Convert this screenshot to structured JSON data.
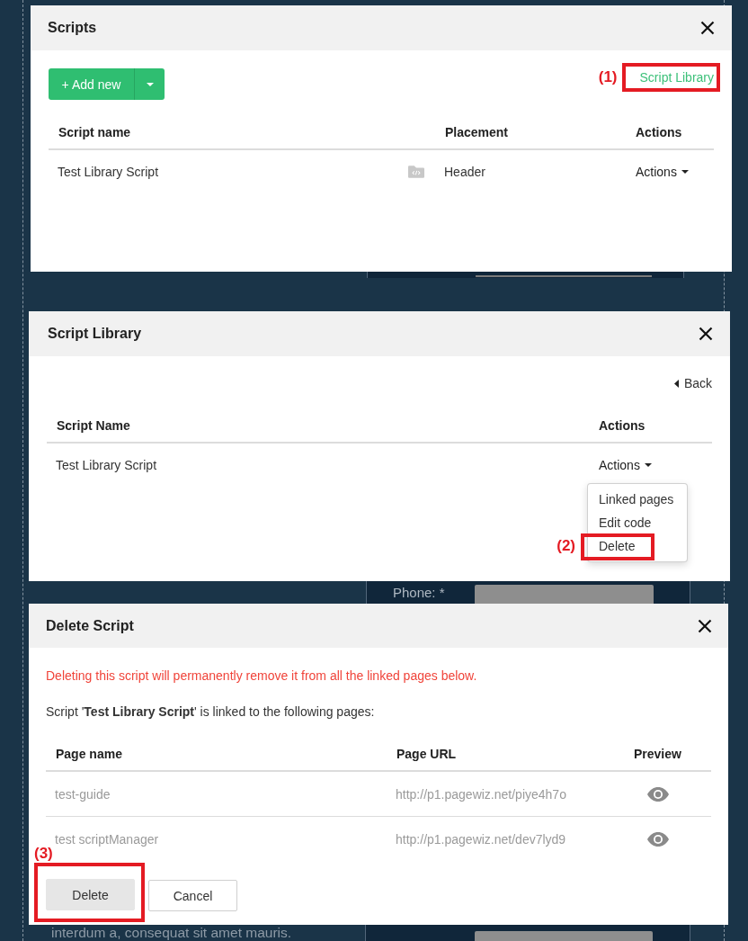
{
  "page_behind": {
    "form_label": "Phone: *",
    "paragraph": "interdum a, consequat sit amet mauris."
  },
  "scripts_dialog": {
    "title": "Scripts",
    "add_button": "+ Add new",
    "library_link": {
      "label": "Script Library",
      "callout": "(1)"
    },
    "columns": [
      "Script name",
      "Placement",
      "Actions"
    ],
    "rows": [
      {
        "name": "Test Library Script",
        "placement": "Header",
        "actions": "Actions"
      }
    ]
  },
  "library_dialog": {
    "title": "Script Library",
    "back_link": "Back",
    "columns": [
      "Script Name",
      "Actions"
    ],
    "rows": [
      {
        "name": "Test Library Script",
        "actions": "Actions",
        "expanded": true,
        "menu": [
          {
            "label": "Linked pages"
          },
          {
            "label": "Edit code"
          },
          {
            "label": "Delete",
            "callout": "(2)"
          }
        ]
      }
    ]
  },
  "delete_dialog": {
    "title": "Delete Script",
    "warning": "Deleting this script will permanently remove it from all the linked pages below.",
    "message": "Script '**Test Library Script**' is linked to the following pages:",
    "columns": [
      "Page name",
      "Page URL",
      "Preview"
    ],
    "rows": [
      {
        "page_name": "test-guide",
        "page_url": "http://p1.pagewiz.net/piye4h7o"
      },
      {
        "page_name": "test scriptManager",
        "page_url": "http://p1.pagewiz.net/dev7lyd9"
      }
    ],
    "buttons": [
      {
        "label": "Delete",
        "kind": "confirm",
        "callout": "(3)"
      },
      {
        "label": "Cancel",
        "kind": "cancel"
      }
    ]
  }
}
